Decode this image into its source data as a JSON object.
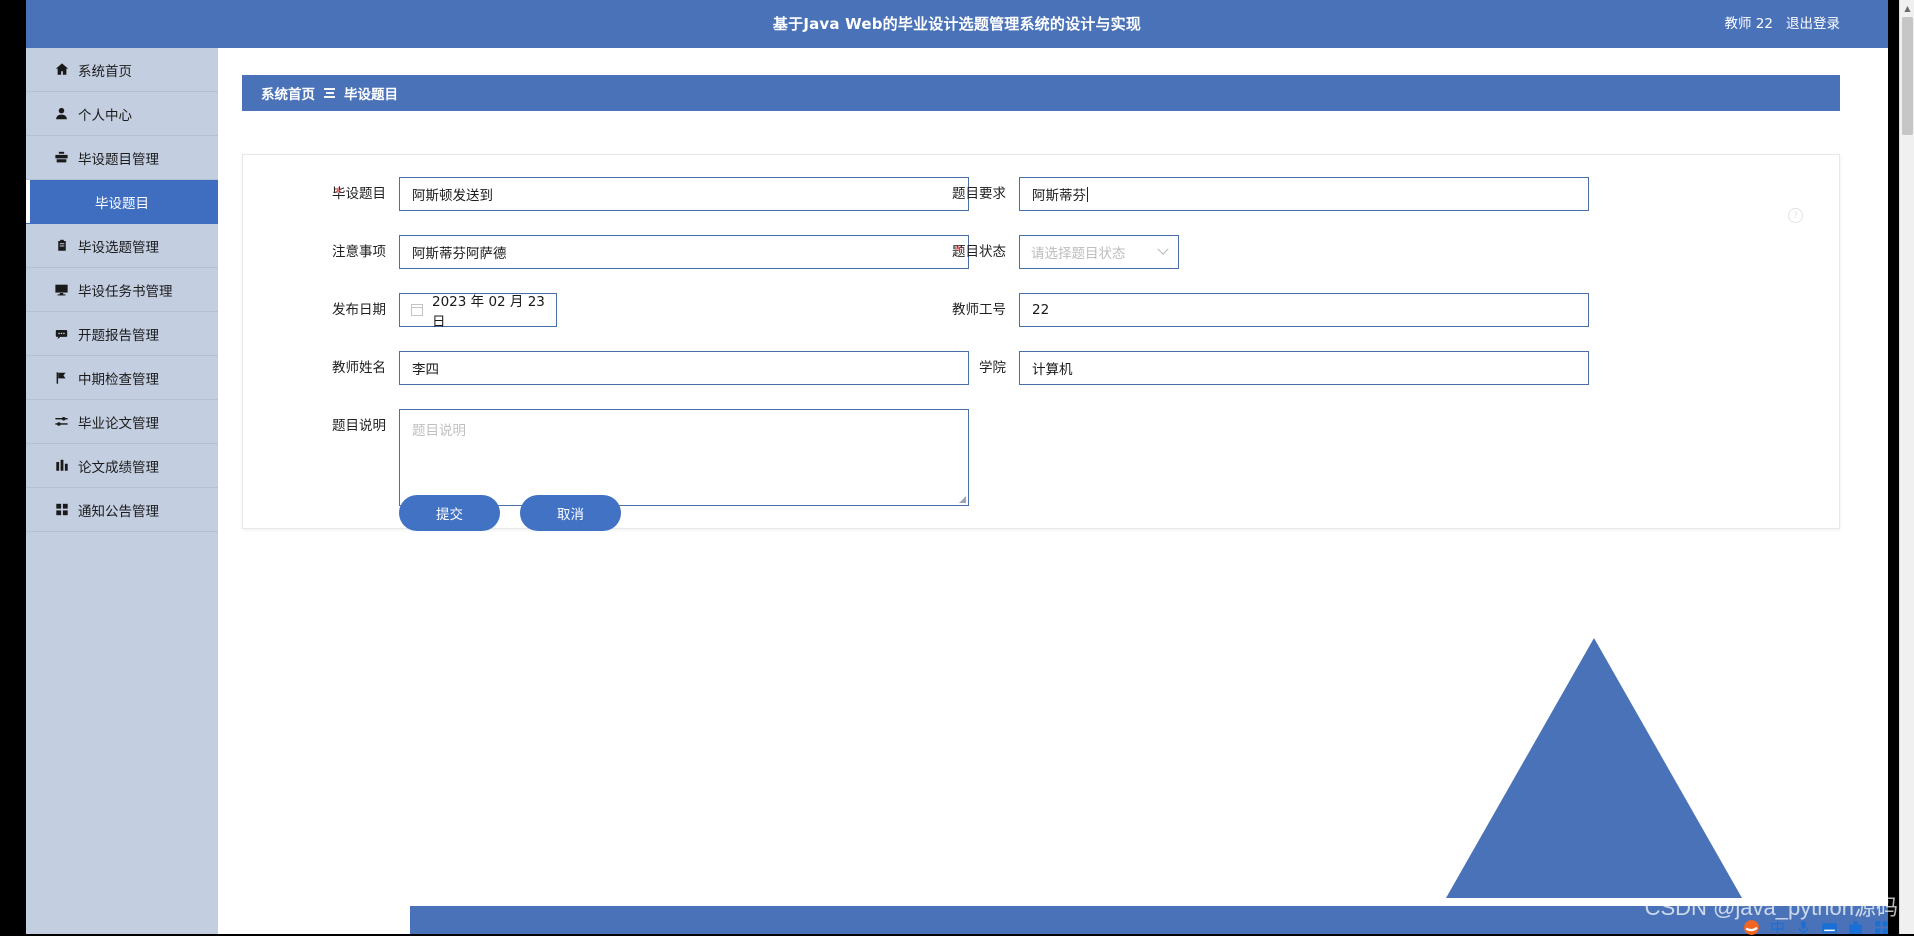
{
  "header": {
    "title": "基于Java Web的毕业设计选题管理系统的设计与实现",
    "user": "教师 22",
    "logout": "退出登录"
  },
  "breadcrumb": {
    "home": "系统首页",
    "current": "毕设题目"
  },
  "sidebar": {
    "items": [
      {
        "label": "系统首页",
        "icon": "home-icon",
        "glyph": "⌂",
        "active": false,
        "sub": false
      },
      {
        "label": "个人中心",
        "icon": "user-icon",
        "glyph": "●",
        "active": false,
        "sub": false
      },
      {
        "label": "毕设题目管理",
        "icon": "briefcase-icon",
        "glyph": "▤",
        "active": false,
        "sub": false
      },
      {
        "label": "毕设题目",
        "icon": "none",
        "glyph": "",
        "active": true,
        "sub": true
      },
      {
        "label": "毕设选题管理",
        "icon": "clipboard-icon",
        "glyph": "▯",
        "active": false,
        "sub": false
      },
      {
        "label": "毕设任务书管理",
        "icon": "monitor-icon",
        "glyph": "▬",
        "active": false,
        "sub": false
      },
      {
        "label": "开题报告管理",
        "icon": "comment-icon",
        "glyph": "▭",
        "active": false,
        "sub": false
      },
      {
        "label": "中期检查管理",
        "icon": "flag-icon",
        "glyph": "⚑",
        "active": false,
        "sub": false
      },
      {
        "label": "毕业论文管理",
        "icon": "sliders-icon",
        "glyph": "≡",
        "active": false,
        "sub": false
      },
      {
        "label": "论文成绩管理",
        "icon": "chart-bar-icon",
        "glyph": "▮",
        "active": false,
        "sub": false
      },
      {
        "label": "通知公告管理",
        "icon": "grid-icon",
        "glyph": "▦",
        "active": false,
        "sub": false
      }
    ]
  },
  "form": {
    "left": {
      "title_label": "毕设题目",
      "title_value": "阿斯顿发送到",
      "notes_label": "注意事项",
      "notes_value": "阿斯蒂芬阿萨德",
      "date_label": "发布日期",
      "date_value": "2023 年 02 月 23 日",
      "teacher_label": "教师姓名",
      "teacher_value": "李四",
      "desc_label": "题目说明",
      "desc_placeholder": "题目说明"
    },
    "right": {
      "require_label": "题目要求",
      "require_value": "阿斯蒂芬",
      "status_label": "题目状态",
      "status_placeholder": "请选择题目状态",
      "teacherno_label": "教师工号",
      "teacherno_value": "22",
      "college_label": "学院",
      "college_value": "计算机"
    },
    "submit_label": "提交",
    "cancel_label": "取消"
  },
  "watermark": "CSDN @java_python源码",
  "colors": {
    "brand_blue": "#4a72b8",
    "active_blue": "#3f6ec0",
    "sidebar_bg": "#c3cee0",
    "input_border": "#4a6fa8",
    "required_red": "#e05c5c",
    "button_blue": "#4272c4"
  }
}
